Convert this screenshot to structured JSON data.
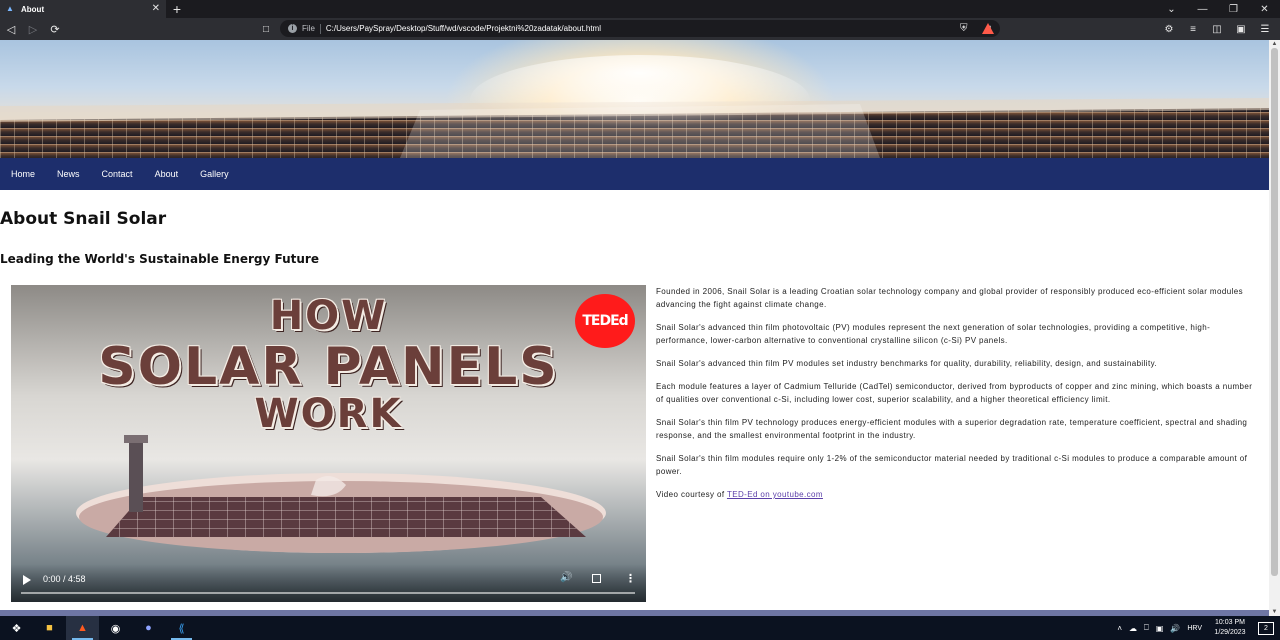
{
  "browser": {
    "tab": {
      "title": "About"
    },
    "url_scheme_label": "File",
    "url": "C:/Users/PaySpray/Desktop/Stuff/wd/vscode/Projektni%20zadatak/about.html"
  },
  "page": {
    "nav": [
      "Home",
      "News",
      "Contact",
      "About",
      "Gallery"
    ],
    "title": "About Snail Solar",
    "subtitle": "Leading the World's Sustainable Energy Future",
    "video": {
      "badge": "TEDEd",
      "title_line1": "HOW",
      "title_line2": "SOLAR PANELS",
      "title_line3": "WORK",
      "time": "0:00 / 4:58"
    },
    "paragraphs": [
      "Founded in 2006, Snail Solar is a leading Croatian solar technology company and global provider of responsibly produced eco-efficient solar modules advancing the fight against climate change.",
      "Snail Solar's advanced thin film photovoltaic (PV) modules represent the next generation of solar technologies, providing a competitive, high-performance, lower-carbon alternative to conventional crystalline silicon (c-Si) PV panels.",
      "Snail Solar's advanced thin film PV modules set industry benchmarks for quality, durability, reliability, design, and sustainability.",
      "Each module features a layer of Cadmium Telluride (CadTel) semiconductor, derived from byproducts of copper and zinc mining, which boasts a number of qualities over conventional c-Si, including lower cost, superior scalability, and a higher theoretical efficiency limit.",
      "Snail Solar's thin film PV technology produces energy-efficient modules with a superior degradation rate, temperature coefficient, spectral and shading response, and the smallest environmental footprint in the industry.",
      "Snail Solar's thin film modules require only 1-2% of the semiconductor material needed by traditional c-Si modules to produce a comparable amount of power."
    ],
    "credit_prefix": "Video courtesy of",
    "credit_link": "TED-Ed on youtube.com"
  },
  "taskbar": {
    "lang": "HRV",
    "time": "10:03 PM",
    "date": "1/29/2023",
    "notifications": "2"
  },
  "colors": {
    "navbar": "#1d2e6c",
    "link": "#5b3fa8",
    "ted_red": "#ff1b1b"
  }
}
